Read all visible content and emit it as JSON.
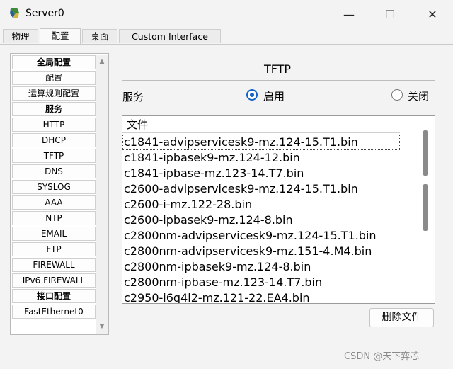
{
  "window": {
    "title": "Server0",
    "controls": {
      "minimize": "—",
      "maximize": "☐",
      "close": "✕"
    }
  },
  "tabs": [
    {
      "label": "物理",
      "active": false
    },
    {
      "label": "配置",
      "active": true
    },
    {
      "label": "桌面",
      "active": false
    },
    {
      "label": "Custom Interface",
      "active": false
    }
  ],
  "sidebar": {
    "items": [
      {
        "label": "全局配置",
        "header": true
      },
      {
        "label": "配置",
        "header": false
      },
      {
        "label": "运算规则配置",
        "header": false
      },
      {
        "label": "服务",
        "header": true
      },
      {
        "label": "HTTP",
        "header": false
      },
      {
        "label": "DHCP",
        "header": false
      },
      {
        "label": "TFTP",
        "header": false
      },
      {
        "label": "DNS",
        "header": false
      },
      {
        "label": "SYSLOG",
        "header": false
      },
      {
        "label": "AAA",
        "header": false
      },
      {
        "label": "NTP",
        "header": false
      },
      {
        "label": "EMAIL",
        "header": false
      },
      {
        "label": "FTP",
        "header": false
      },
      {
        "label": "FIREWALL",
        "header": false
      },
      {
        "label": "IPv6 FIREWALL",
        "header": false
      },
      {
        "label": "接口配置",
        "header": true
      },
      {
        "label": "FastEthernet0",
        "header": false
      }
    ],
    "scroll_up": "▲",
    "scroll_down": "▼"
  },
  "main": {
    "title": "TFTP",
    "service_label": "服务",
    "radio_on_label": "启用",
    "radio_off_label": "关闭",
    "service_enabled": true,
    "file_header": "文件",
    "files": [
      "c1841-advipservicesk9-mz.124-15.T1.bin",
      "c1841-ipbasek9-mz.124-12.bin",
      "c1841-ipbase-mz.123-14.T7.bin",
      "c2600-advipservicesk9-mz.124-15.T1.bin",
      "c2600-i-mz.122-28.bin",
      "c2600-ipbasek9-mz.124-8.bin",
      "c2800nm-advipservicesk9-mz.124-15.T1.bin",
      "c2800nm-advipservicesk9-mz.151-4.M4.bin",
      "c2800nm-ipbasek9-mz.124-8.bin",
      "c2800nm-ipbase-mz.123-14.T7.bin",
      "c2950-i6q4l2-mz.121-22.EA4.bin"
    ],
    "selected_file_index": 0,
    "delete_button": "删除文件"
  },
  "watermark": "CSDN @天下弈芯",
  "colors": {
    "accent": "#1466c8",
    "background": "#f3f3f3"
  }
}
